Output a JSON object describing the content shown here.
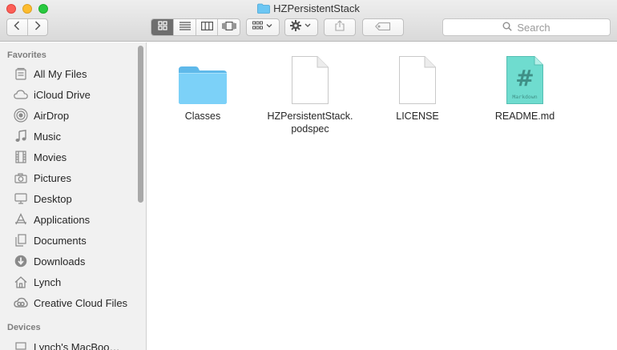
{
  "window": {
    "title": "HZPersistentStack",
    "title_icon": "folder-icon"
  },
  "toolbar": {
    "back_icon": "chevron-left-icon",
    "forward_icon": "chevron-right-icon",
    "view_modes": [
      {
        "name": "icon-view",
        "active": true
      },
      {
        "name": "list-view",
        "active": false
      },
      {
        "name": "column-view",
        "active": false
      },
      {
        "name": "cover-flow-view",
        "active": false
      }
    ],
    "arrange_icon": "arrange-grid-icon",
    "action_icon": "gear-icon",
    "share_icon": "share-icon",
    "tag_icon": "tag-icon",
    "search_placeholder": "Search"
  },
  "sidebar": {
    "favorites_heading": "Favorites",
    "items": [
      {
        "label": "All My Files",
        "icon": "all-files-icon"
      },
      {
        "label": "iCloud Drive",
        "icon": "cloud-icon"
      },
      {
        "label": "AirDrop",
        "icon": "airdrop-icon"
      },
      {
        "label": "Music",
        "icon": "music-icon"
      },
      {
        "label": "Movies",
        "icon": "film-icon"
      },
      {
        "label": "Pictures",
        "icon": "camera-icon"
      },
      {
        "label": "Desktop",
        "icon": "desktop-icon"
      },
      {
        "label": "Applications",
        "icon": "applications-icon"
      },
      {
        "label": "Documents",
        "icon": "document-icon"
      },
      {
        "label": "Downloads",
        "icon": "download-icon"
      },
      {
        "label": "Lynch",
        "icon": "home-icon"
      },
      {
        "label": "Creative Cloud Files",
        "icon": "creative-cloud-icon"
      }
    ],
    "devices_heading": "Devices",
    "devices": [
      {
        "label": "Lynch's MacBoo…",
        "icon": "laptop-icon"
      }
    ]
  },
  "files": [
    {
      "name_lines": [
        "Classes"
      ],
      "kind": "folder"
    },
    {
      "name_lines": [
        "HZPersistentStack.",
        "podspec"
      ],
      "kind": "document"
    },
    {
      "name_lines": [
        "LICENSE"
      ],
      "kind": "document"
    },
    {
      "name_lines": [
        "README.md"
      ],
      "kind": "markdown",
      "badge_symbol": "#",
      "badge_text": "Markdown"
    }
  ],
  "colors": {
    "folder": "#6cc6f3",
    "markdown_badge": "#6fdccf",
    "active_view_segment": "#6e6e6e"
  }
}
